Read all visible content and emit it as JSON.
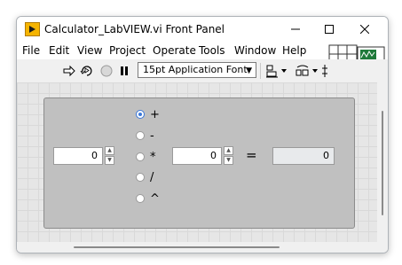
{
  "window": {
    "title": "Calculator_LabVIEW.vi Front Panel"
  },
  "menu": [
    "File",
    "Edit",
    "View",
    "Project",
    "Operate",
    "Tools",
    "Window",
    "Help"
  ],
  "toolbar": {
    "font": "15pt Application Font"
  },
  "operations": {
    "options": [
      "+",
      "-",
      "*",
      "/",
      "^"
    ],
    "selected": "+"
  },
  "inputs": {
    "x": "0",
    "y": "0"
  },
  "equals": "=",
  "result": "0",
  "colors": {
    "accent": "#f5b400",
    "panel": "#c0c0c0",
    "radio_selected": "#3c78d8"
  }
}
